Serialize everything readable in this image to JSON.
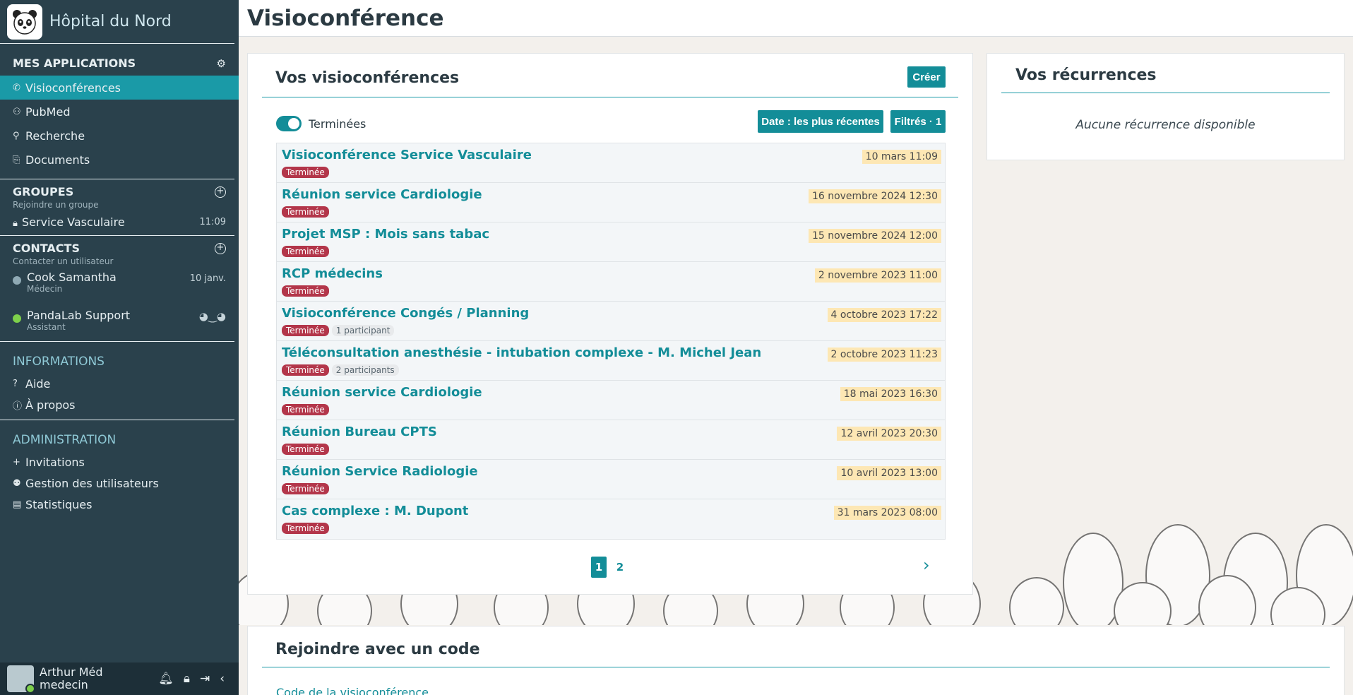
{
  "brand": {
    "name": "Hôpital du Nord"
  },
  "sidebar": {
    "apps_title": "MES APPLICATIONS",
    "apps": [
      {
        "label": "Visioconférences",
        "icon": "phone-icon",
        "active": true
      },
      {
        "label": "PubMed",
        "icon": "pubmed-icon"
      },
      {
        "label": "Recherche",
        "icon": "search-icon"
      },
      {
        "label": "Documents",
        "icon": "paperclip-icon"
      }
    ],
    "groups_title": "GROUPES",
    "groups_sub": "Rejoindre un groupe",
    "groups": [
      {
        "label": "Service Vasculaire",
        "time": "11:09"
      }
    ],
    "contacts_title": "CONTACTS",
    "contacts_sub": "Contacter un utilisateur",
    "contacts": [
      {
        "name": "Cook Samantha",
        "role": "Médecin",
        "time": "10 janv.",
        "status_color": "#8fa9b4"
      },
      {
        "name": "PandaLab Support",
        "role": "Assistant",
        "time": "",
        "status_color": "#7ed04b"
      }
    ],
    "info_title": "INFORMATIONS",
    "info": [
      {
        "label": "Aide",
        "icon": "question-icon"
      },
      {
        "label": "À propos",
        "icon": "info-icon"
      }
    ],
    "admin_title": "ADMINISTRATION",
    "admin": [
      {
        "label": "Invitations",
        "icon": "plus-icon"
      },
      {
        "label": "Gestion des utilisateurs",
        "icon": "users-icon"
      },
      {
        "label": "Statistiques",
        "icon": "stats-icon"
      }
    ]
  },
  "user": {
    "name": "Arthur Méd",
    "role": "medecin"
  },
  "page": {
    "title": "Visioconférence"
  },
  "visios": {
    "title": "Vos visioconférences",
    "create_label": "Créer",
    "toggle_label": "Terminées",
    "sort_label": "Date : les plus récentes",
    "filter_label": "Filtrés · 1",
    "items": [
      {
        "title": "Visioconférence Service Vasculaire",
        "status": "Terminée",
        "participants": "",
        "date": "10 mars 11:09"
      },
      {
        "title": "Réunion service Cardiologie",
        "status": "Terminée",
        "participants": "",
        "date": "16 novembre 2024 12:30"
      },
      {
        "title": "Projet MSP : Mois sans tabac",
        "status": "Terminée",
        "participants": "",
        "date": "15 novembre 2024 12:00"
      },
      {
        "title": "RCP médecins",
        "status": "Terminée",
        "participants": "",
        "date": "2 novembre 2023 11:00"
      },
      {
        "title": "Visioconférence Congés / Planning",
        "status": "Terminée",
        "participants": "1 participant",
        "date": "4 octobre 2023 17:22"
      },
      {
        "title": "Téléconsultation anesthésie - intubation complexe - M. Michel Jean",
        "status": "Terminée",
        "participants": "2 participants",
        "date": "2 octobre 2023 11:23"
      },
      {
        "title": "Réunion service Cardiologie",
        "status": "Terminée",
        "participants": "",
        "date": "18 mai 2023 16:30"
      },
      {
        "title": "Réunion Bureau CPTS",
        "status": "Terminée",
        "participants": "",
        "date": "12 avril 2023 20:30"
      },
      {
        "title": "Réunion Service Radiologie",
        "status": "Terminée",
        "participants": "",
        "date": "10 avril 2023 13:00"
      },
      {
        "title": "Cas complexe : M. Dupont",
        "status": "Terminée",
        "participants": "",
        "date": "31 mars 2023 08:00"
      }
    ],
    "pages": [
      "1",
      "2"
    ],
    "current_page": "1"
  },
  "recurrences": {
    "title": "Vos récurrences",
    "empty": "Aucune récurrence disponible"
  },
  "join": {
    "title": "Rejoindre avec un code",
    "field_label": "Code de la visioconférence"
  },
  "colors": {
    "accent": "#138d98",
    "sidebar": "#2a414c",
    "status_done": "#b3364a",
    "date_bg": "#fde7b4"
  }
}
